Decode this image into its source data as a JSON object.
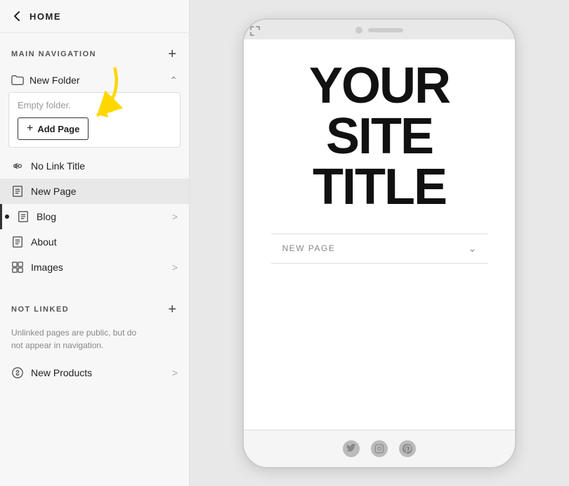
{
  "header": {
    "back_label": "HOME",
    "back_icon": "arrow-left"
  },
  "main_nav": {
    "section_title": "MAIN NAVIGATION",
    "add_icon": "+",
    "folder": {
      "name": "New Folder",
      "empty_text": "Empty folder.",
      "add_page_label": "Add Page"
    },
    "items": [
      {
        "label": "No Link Title",
        "icon": "link-icon",
        "chevron": false
      },
      {
        "label": "New Page",
        "icon": "page-icon",
        "chevron": false,
        "active": true
      },
      {
        "label": "Blog",
        "icon": "page-icon",
        "chevron": true,
        "home": true
      },
      {
        "label": "About",
        "icon": "page-icon",
        "chevron": false
      },
      {
        "label": "Images",
        "icon": "grid-icon",
        "chevron": true
      }
    ]
  },
  "not_linked": {
    "section_title": "NOT LINKED",
    "description": "Unlinked pages are public, but do\nnot appear in navigation.",
    "items": [
      {
        "label": "New Products",
        "icon": "dollar-icon",
        "chevron": true
      }
    ]
  },
  "preview": {
    "site_title_line1": "YOUR",
    "site_title_line2": "SITE",
    "site_title_line3": "TITLE",
    "nav_label": "NEW PAGE",
    "social_icons": [
      "twitter",
      "instagram",
      "pinterest"
    ]
  }
}
